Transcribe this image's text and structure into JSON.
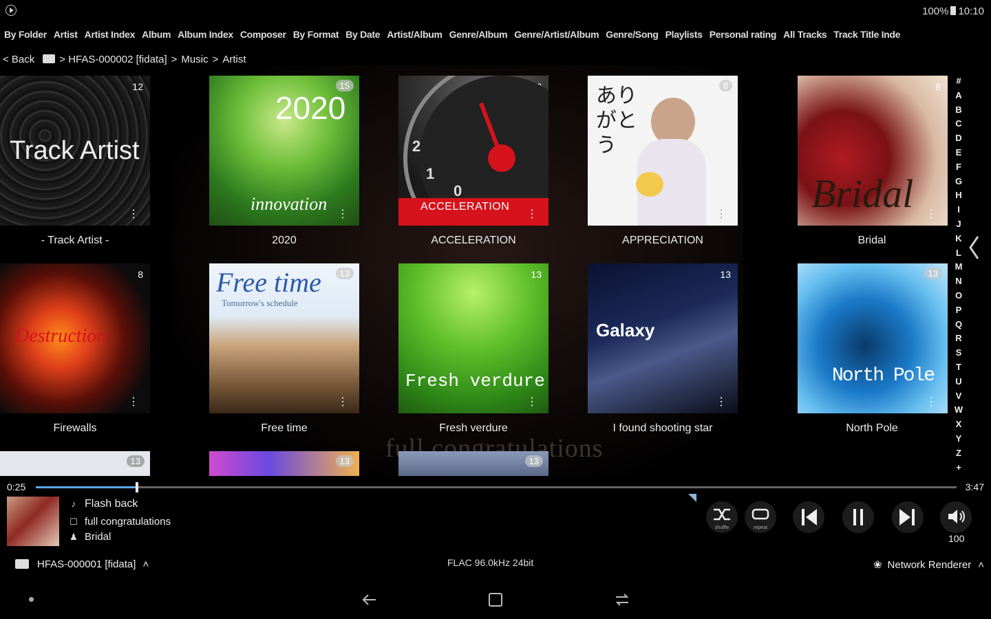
{
  "status": {
    "battery": "100%",
    "time": "10:10"
  },
  "tabs": [
    "By Folder",
    "Artist",
    "Artist Index",
    "Album",
    "Album Index",
    "Composer",
    "By Format",
    "By Date",
    "Artist/Album",
    "Genre/Album",
    "Genre/Artist/Album",
    "Genre/Song",
    "Playlists",
    "Personal rating",
    "All Tracks",
    "Track Title Inde"
  ],
  "breadcrumb": {
    "back": "< Back",
    "server": "> HFAS-000002 [fidata]",
    "sep1": ">",
    "music": "Music",
    "sep2": ">",
    "current": "Artist"
  },
  "tiles": [
    {
      "count": "12",
      "art": "Track Artist",
      "caption": "- Track Artist -"
    },
    {
      "count": "15",
      "art": "2020",
      "art2": "innovation",
      "caption": "2020"
    },
    {
      "count": "13",
      "art": "ACCELERATION",
      "caption": "ACCELERATION"
    },
    {
      "count": "8",
      "art": "ありがとう",
      "caption": "APPRECIATION"
    },
    {
      "count": "8",
      "art": "Bridal",
      "caption": "Bridal"
    },
    {
      "count": "8",
      "art": "Destruction",
      "caption": "Firewalls"
    },
    {
      "count": "13",
      "art": "Free time",
      "art2": "Tomorrow's schedule",
      "caption": "Free time"
    },
    {
      "count": "13",
      "art": "Fresh verdure",
      "caption": "Fresh verdure"
    },
    {
      "count": "13",
      "art": "Galaxy",
      "caption": "I found shooting star"
    },
    {
      "count": "13",
      "art": "North Pole",
      "caption": "North Pole"
    },
    {
      "count": "13"
    },
    {
      "count": "13"
    },
    {
      "count": "13"
    }
  ],
  "alphabet": [
    "#",
    "A",
    "B",
    "C",
    "D",
    "E",
    "F",
    "G",
    "H",
    "I",
    "J",
    "K",
    "L",
    "M",
    "N",
    "O",
    "P",
    "Q",
    "R",
    "S",
    "T",
    "U",
    "V",
    "W",
    "X",
    "Y",
    "Z",
    "+"
  ],
  "background_text": "full congratulations",
  "playback": {
    "elapsed": "0:25",
    "total": "3:47",
    "progress": 0.11
  },
  "now_playing": {
    "title": "Flash back",
    "album": "full congratulations",
    "artist": "Bridal"
  },
  "controls": {
    "shuffle_label": "shuffle",
    "repeat_label": "repeat",
    "volume": "100"
  },
  "footer": {
    "server": "HFAS-000001 [fidata]",
    "format": "FLAC 96.0kHz 24bit",
    "renderer": "Network Renderer"
  },
  "colors": {
    "progress_fill": "#5aa8e6",
    "accel_red": "#d6121c"
  },
  "icons": [
    "play-circle-icon",
    "battery-icon",
    "folder-icon",
    "more-icon",
    "shuffle-icon",
    "repeat-icon",
    "previous-icon",
    "pause-icon",
    "next-icon",
    "volume-icon",
    "server-icon",
    "renderer-icon",
    "chevron-up-icon",
    "chevron-left-icon",
    "back-nav-icon",
    "recents-nav-icon",
    "overview-nav-icon"
  ]
}
